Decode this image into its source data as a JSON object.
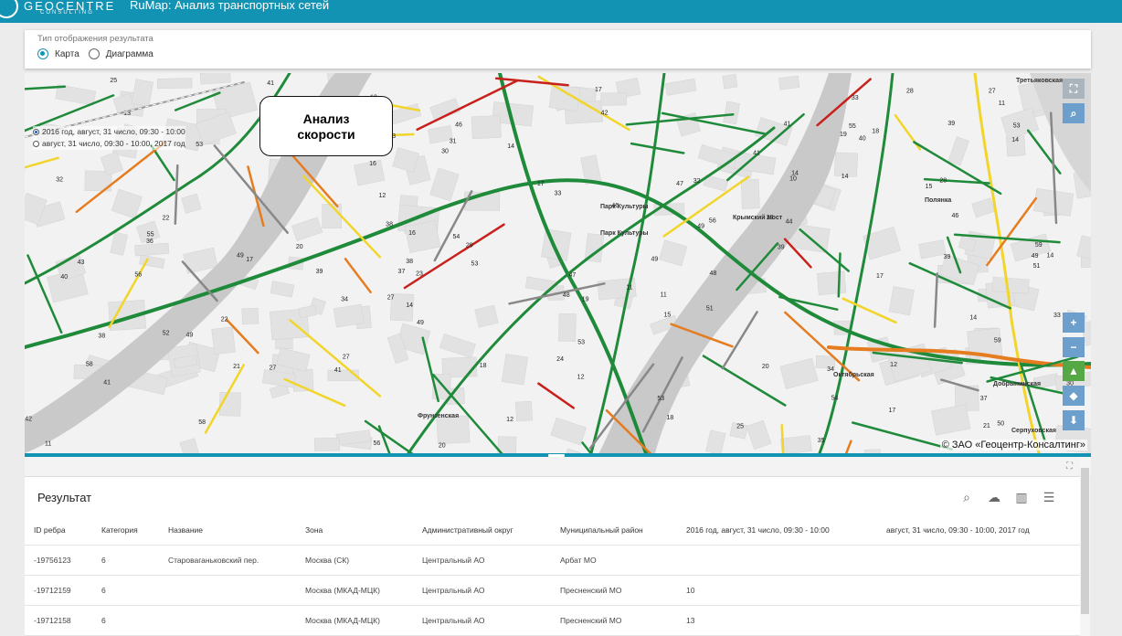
{
  "header": {
    "logo_text": "GEOCENTRE",
    "logo_sub": "CONSULTING",
    "app_title": "RuMap: Анализ транспортных сетей",
    "bg_color": "#1393b3"
  },
  "mode": {
    "label": "Тип отображения результата",
    "options": [
      {
        "label": "Карта",
        "selected": true
      },
      {
        "label": "Диаграмма",
        "selected": false
      }
    ]
  },
  "map": {
    "layers": [
      {
        "label": "2016 год, август, 31 число, 09:30 - 10:00",
        "selected": true
      },
      {
        "label": "август, 31 число, 09:30 - 10:00, 2017 год",
        "selected": false
      }
    ],
    "callout": "Анализ\nскорости",
    "copyright": "© ЗАО «Геоцентр-Консалтинг»",
    "controls": [
      {
        "name": "fullscreen-icon",
        "glyph": "⛶"
      },
      {
        "name": "zoom-search-icon",
        "glyph": "🔍"
      },
      {
        "name": "zoom-in-icon",
        "glyph": "+"
      },
      {
        "name": "zoom-out-icon",
        "glyph": "−"
      },
      {
        "name": "route-icon",
        "glyph": "▲"
      },
      {
        "name": "layers-icon",
        "glyph": "◆"
      },
      {
        "name": "download-icon",
        "glyph": "⬇"
      }
    ],
    "place_labels": [
      "Парк Культуры",
      "Парк Культуры",
      "Октябрьская",
      "Добрынинская",
      "Серпуховская",
      "Полянка",
      "Третьяковская",
      "Фрунзенская",
      "Крымский мост"
    ],
    "speed_colors": {
      "free": "#1f8a3a",
      "medium": "#f2d52a",
      "slow": "#e57c1f",
      "jam": "#c8201a",
      "nodata": "#888888"
    }
  },
  "results": {
    "title": "Результат",
    "tools": [
      "search-icon",
      "cloud-download-icon",
      "columns-icon",
      "filter-icon"
    ],
    "columns": [
      "ID ребра",
      "Категория",
      "Название",
      "Зона",
      "Административный округ",
      "Муниципальный район",
      "2016 год, август, 31 число, 09:30 - 10:00",
      "август, 31 число, 09:30 - 10:00, 2017 год"
    ],
    "rows": [
      [
        "-19756123",
        "6",
        "Староваганьковский пер.",
        "Москва (СК)",
        "Центральный АО",
        "Арбат МО",
        "",
        ""
      ],
      [
        "-19712159",
        "6",
        "",
        "Москва (МКАД-МЦК)",
        "Центральный АО",
        "Пресненский МО",
        "10",
        ""
      ],
      [
        "-19712158",
        "6",
        "",
        "Москва (МКАД-МЦК)",
        "Центральный АО",
        "Пресненский МО",
        "13",
        ""
      ]
    ]
  }
}
